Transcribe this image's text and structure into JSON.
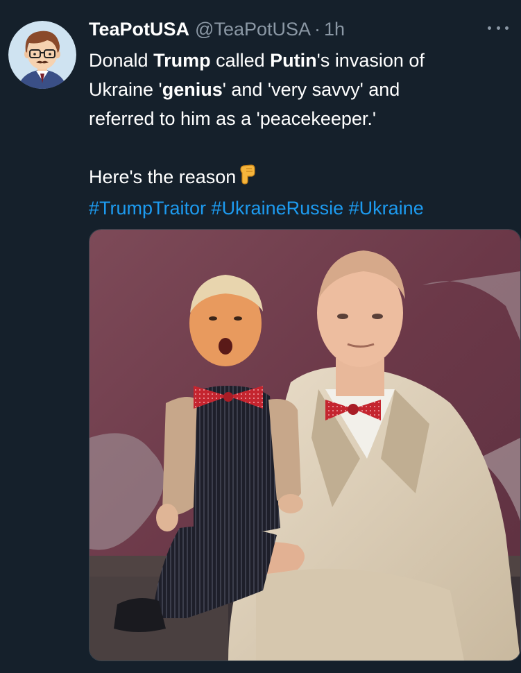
{
  "tweet": {
    "author": {
      "display_name": "TeaPotUSA",
      "handle": "@TeaPotUSA",
      "avatar_icon": "cartoon-man-avatar-icon"
    },
    "separator": "·",
    "timestamp": "1h",
    "more_icon": "more-options-icon",
    "text": {
      "line1": {
        "t1": "Donald ",
        "b1": "Trump",
        "t2": " called ",
        "b2": "Putin",
        "t3": "'s invasion of"
      },
      "line2": {
        "t1": "Ukraine '",
        "b1": "genius",
        "t2": "' and 'very savvy' and"
      },
      "line3": "referred to him as a 'peacekeeper.'",
      "line4": "Here's the reason",
      "emoji": "backhand-index-pointing-down-icon"
    },
    "hashtags": [
      "#TrumpTraitor",
      "#UkraineRussie",
      "#Ukraine"
    ],
    "media": {
      "type": "photo",
      "description_icon": "ventriloquist-photo"
    },
    "colors": {
      "background": "#15202b",
      "link": "#1d9bf0",
      "secondary_text": "#8b98a5"
    }
  }
}
